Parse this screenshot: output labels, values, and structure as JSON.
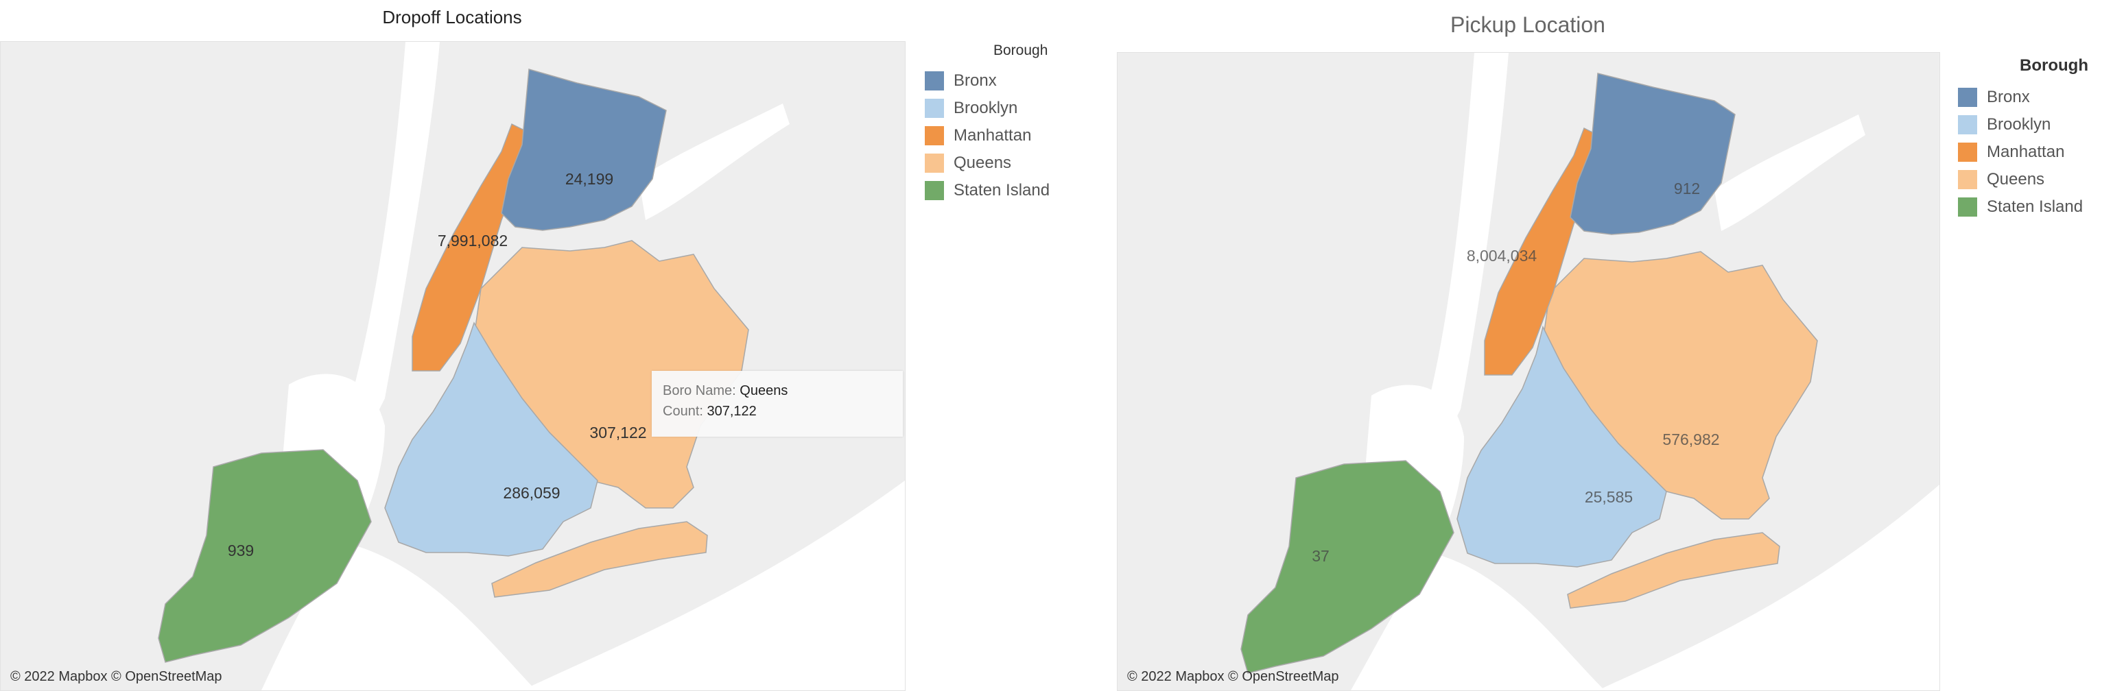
{
  "legend_title": "Borough",
  "boroughs": [
    {
      "name": "Bronx",
      "color": "#6b8eb5"
    },
    {
      "name": "Brooklyn",
      "color": "#b2d0ea"
    },
    {
      "name": "Manhattan",
      "color": "#f09445"
    },
    {
      "name": "Queens",
      "color": "#f9c48f"
    },
    {
      "name": "Staten Island",
      "color": "#72aa68"
    }
  ],
  "credit": "© 2022 Mapbox © OpenStreetMap",
  "dropoff": {
    "title": "Dropoff Locations",
    "counts": {
      "Bronx": "24,199",
      "Manhattan": "7,991,082",
      "Queens": "307,122",
      "Brooklyn": "286,059",
      "Staten Island": "939"
    },
    "tooltip": {
      "name_label": "Boro Name:",
      "name_value": "Queens",
      "count_label": "Count:",
      "count_value": "307,122"
    }
  },
  "pickup": {
    "title": "Pickup Location",
    "counts": {
      "Bronx": "912",
      "Manhattan": "8,004,034",
      "Queens": "576,982",
      "Brooklyn": "25,585",
      "Staten Island": "37"
    }
  }
}
